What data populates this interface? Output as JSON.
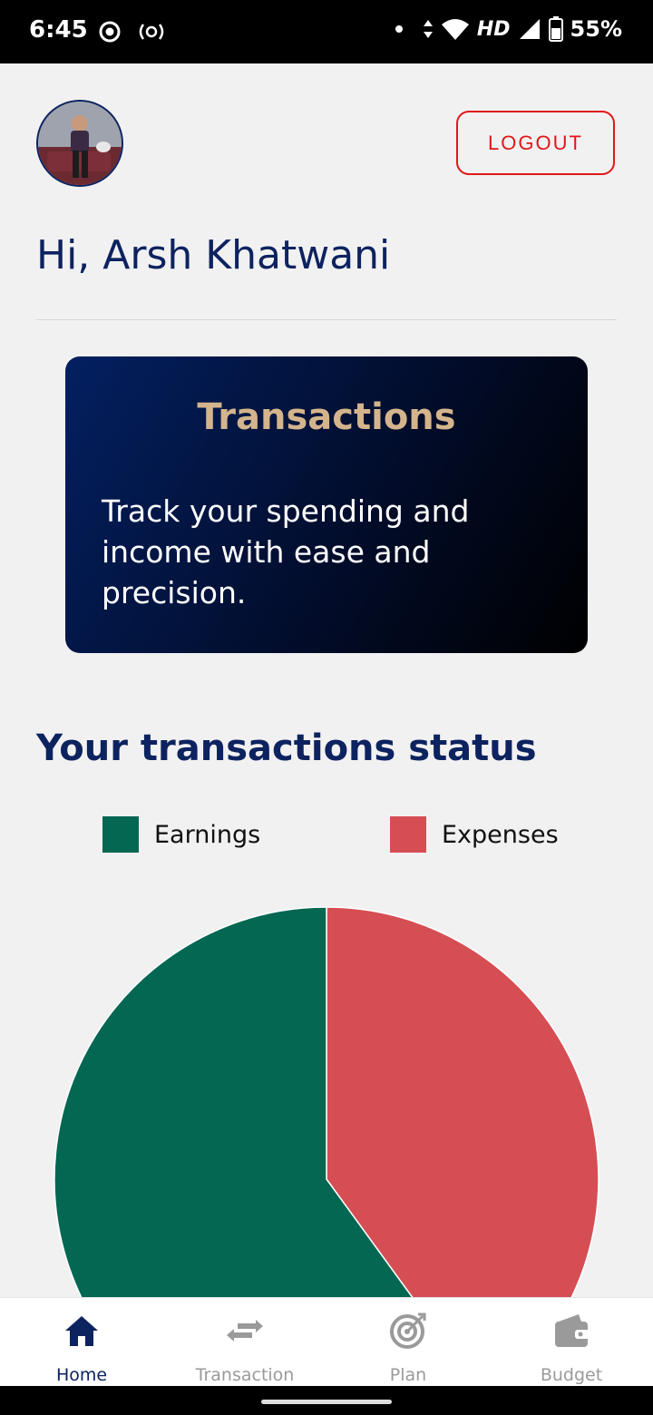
{
  "status_bar": {
    "time": "6:45",
    "network": "HD",
    "battery": "55%",
    "icons": [
      "record-icon",
      "hotspot-icon",
      "dot-icon",
      "data-arrows-icon",
      "wifi-icon",
      "signal-icon",
      "battery-icon"
    ]
  },
  "header": {
    "avatar_icon": "user-avatar",
    "logout_label": "LOGOUT"
  },
  "greeting": "Hi, Arsh Khatwani",
  "card": {
    "title": "Transactions",
    "body": "Track your spending and income with ease and precision."
  },
  "section_title": "Your transactions status",
  "colors": {
    "earnings": "#036752",
    "expenses": "#d54e53",
    "primary": "#0d2360",
    "accent": "#d4b48c",
    "danger": "#e01818"
  },
  "chart_data": {
    "type": "pie",
    "categories": [
      "Earnings",
      "Expenses"
    ],
    "values": [
      60,
      40
    ],
    "legend": "top"
  },
  "legend": {
    "earnings_label": "Earnings",
    "expenses_label": "Expenses"
  },
  "nav": {
    "home_label": "Home",
    "transaction_label": "Transaction",
    "plan_label": "Plan",
    "budget_label": "Budget",
    "active": "Home"
  }
}
